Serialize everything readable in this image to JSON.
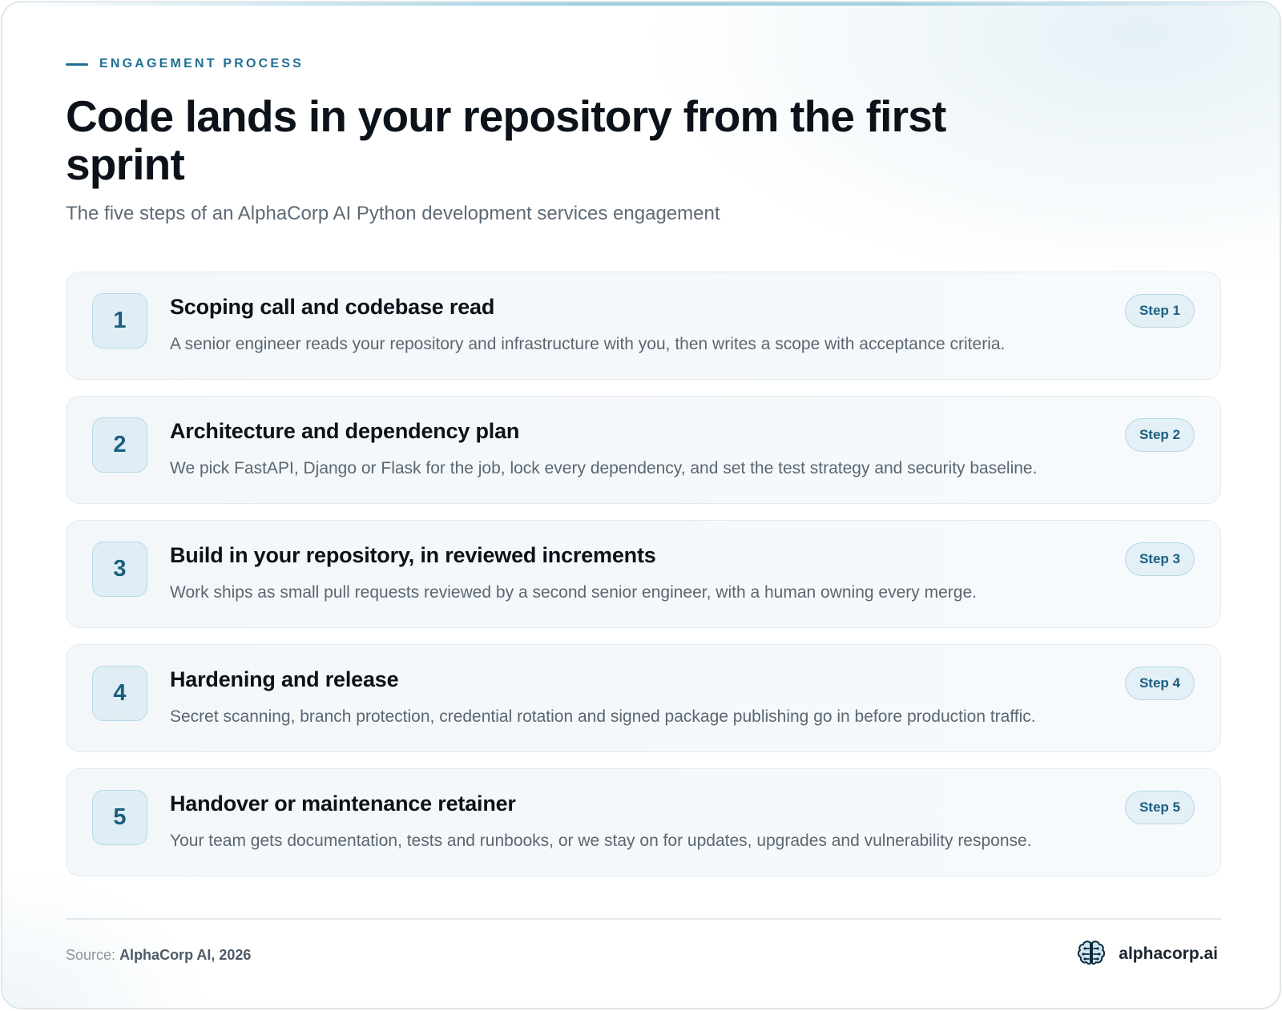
{
  "header": {
    "eyebrow": "ENGAGEMENT PROCESS",
    "title": "Code lands in your repository from the first sprint",
    "subtitle": "The five steps of an AlphaCorp AI Python development services engagement"
  },
  "steps": [
    {
      "number": "1",
      "title": "Scoping call and codebase read",
      "description": "A senior engineer reads your repository and infrastructure with you, then writes a scope with acceptance criteria.",
      "badge": "Step 1"
    },
    {
      "number": "2",
      "title": "Architecture and dependency plan",
      "description": "We pick FastAPI, Django or Flask for the job, lock every dependency, and set the test strategy and security baseline.",
      "badge": "Step 2"
    },
    {
      "number": "3",
      "title": "Build in your repository, in reviewed increments",
      "description": "Work ships as small pull requests reviewed by a second senior engineer, with a human owning every merge.",
      "badge": "Step 3"
    },
    {
      "number": "4",
      "title": "Hardening and release",
      "description": "Secret scanning, branch protection, credential rotation and signed package publishing go in before production traffic.",
      "badge": "Step 4"
    },
    {
      "number": "5",
      "title": "Handover or maintenance retainer",
      "description": "Your team gets documentation, tests and runbooks, or we stay on for updates, upgrades and vulnerability response.",
      "badge": "Step 5"
    }
  ],
  "footer": {
    "source_label": "Source:",
    "source_value": "AlphaCorp AI, 2026",
    "brand_name": "alphacorp.ai",
    "brand_icon": "brain-icon"
  },
  "colors": {
    "accent": "#1f6f93",
    "title": "#0c1219",
    "muted": "#5a6672"
  }
}
